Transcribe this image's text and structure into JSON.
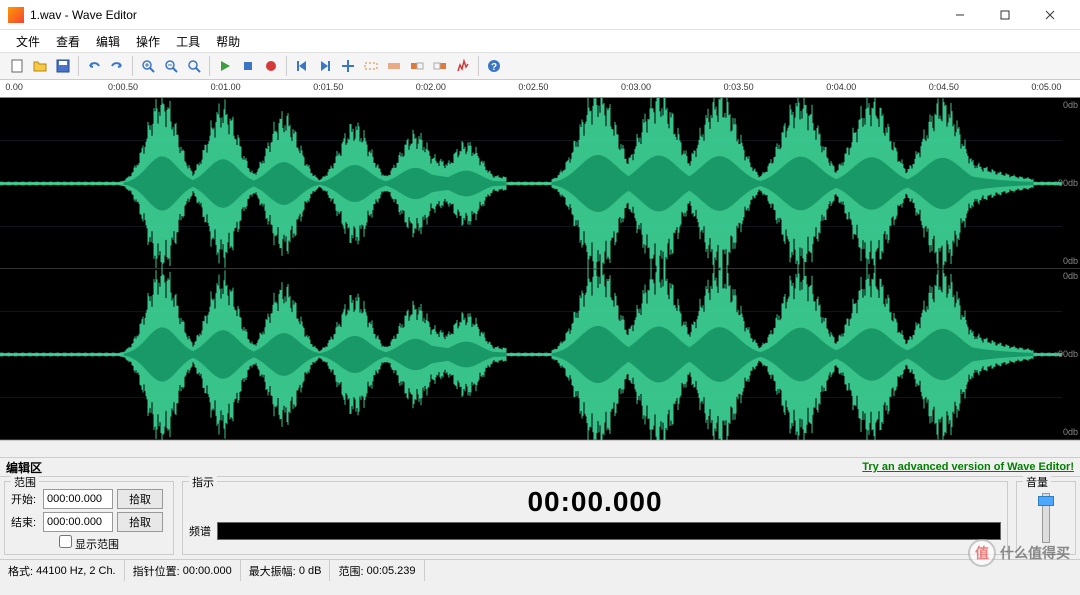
{
  "window": {
    "title": "1.wav - Wave Editor",
    "minimize": "—",
    "maximize": "☐",
    "close": "✕"
  },
  "menu": {
    "file": "文件",
    "view": "查看",
    "edit": "编辑",
    "operate": "操作",
    "tools": "工具",
    "help": "帮助"
  },
  "toolbar_icons": {
    "new": "new-file-icon",
    "open": "open-folder-icon",
    "save": "save-icon",
    "undo": "undo-icon",
    "redo": "redo-icon",
    "zoom_in": "zoom-in-icon",
    "zoom_out": "zoom-out-icon",
    "zoom_fit": "zoom-fit-icon",
    "play": "play-icon",
    "stop": "stop-icon",
    "record": "record-icon",
    "skip_start": "skip-start-icon",
    "skip_end": "skip-end-icon",
    "add_marker": "add-marker-icon",
    "sel_all": "select-all-icon",
    "sel_none": "select-none-icon",
    "sel_left": "select-left-icon",
    "sel_right": "select-right-icon",
    "normalize": "normalize-icon",
    "help": "help-icon"
  },
  "ruler": {
    "ticks": [
      "0.00",
      "0:00.50",
      "0:01.00",
      "0:01.50",
      "0:02.00",
      "0:02.50",
      "0:03.00",
      "0:03.50",
      "0:04.00",
      "0:04.50",
      "0:05.00"
    ]
  },
  "db_labels": {
    "top": "0db",
    "mid": "-90db",
    "bot": "0db"
  },
  "edit_area": {
    "label": "编辑区",
    "link": "Try an advanced version of Wave Editor!"
  },
  "range": {
    "legend": "范围",
    "start_label": "开始:",
    "end_label": "结束:",
    "start_value": "000:00.000",
    "end_value": "000:00.000",
    "pick_button": "拾取",
    "show_range": "显示范围"
  },
  "indicator": {
    "legend": "指示",
    "time": "00:00.000",
    "spectrum_label": "频谱"
  },
  "volume": {
    "legend": "音量"
  },
  "status": {
    "format_label": "格式:",
    "format_value": "44100 Hz, 2 Ch.",
    "pointer_label": "指针位置:",
    "pointer_value": "00:00.000",
    "amplitude_label": "最大振幅:",
    "amplitude_value": "0 dB",
    "range_label": "范围:",
    "range_value": "00:05.239"
  },
  "watermark": {
    "char": "值",
    "text": "什么值得买"
  },
  "colors": {
    "waveform": "#42e6a4",
    "waveform_dark": "#1a9968",
    "bg": "#000000"
  }
}
